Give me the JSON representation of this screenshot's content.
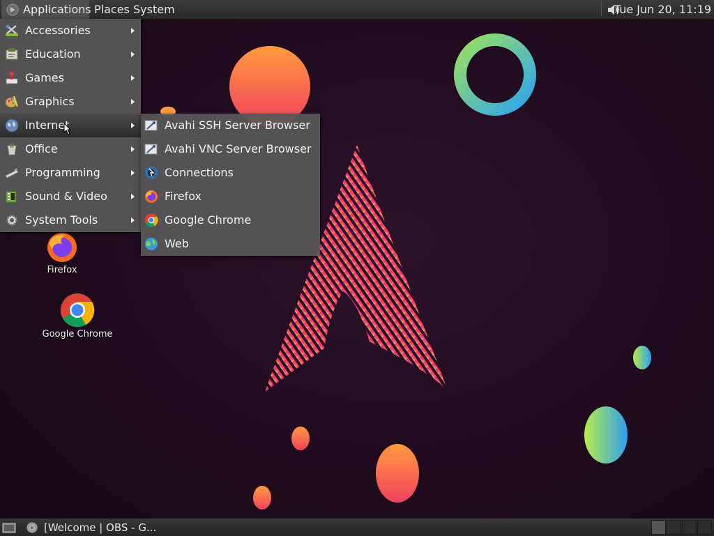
{
  "top_panel": {
    "menus": [
      "Applications",
      "Places",
      "System"
    ],
    "clock": "Tue Jun 20, 11:19"
  },
  "applications_menu": {
    "items": [
      {
        "label": "Accessories",
        "icon": "accessories-icon"
      },
      {
        "label": "Education",
        "icon": "education-icon"
      },
      {
        "label": "Games",
        "icon": "games-icon"
      },
      {
        "label": "Graphics",
        "icon": "graphics-icon"
      },
      {
        "label": "Internet",
        "icon": "globe-icon",
        "highlighted": true
      },
      {
        "label": "Office",
        "icon": "office-icon"
      },
      {
        "label": "Programming",
        "icon": "programming-icon"
      },
      {
        "label": "Sound & Video",
        "icon": "sound-video-icon"
      },
      {
        "label": "System Tools",
        "icon": "gear-icon"
      }
    ]
  },
  "internet_submenu": {
    "items": [
      {
        "label": "Avahi SSH Server Browser",
        "icon": "avahi-ssh-icon"
      },
      {
        "label": "Avahi VNC Server Browser",
        "icon": "avahi-vnc-icon"
      },
      {
        "label": "Connections",
        "icon": "connections-icon"
      },
      {
        "label": "Firefox",
        "icon": "firefox-icon"
      },
      {
        "label": "Google Chrome",
        "icon": "chrome-icon"
      },
      {
        "label": "Web",
        "icon": "web-icon"
      }
    ]
  },
  "desktop_icons": [
    {
      "label": "Firefox",
      "icon": "firefox-icon"
    },
    {
      "label": "Google Chrome",
      "icon": "chrome-icon"
    }
  ],
  "bottom_panel": {
    "task": "[Welcome | OBS - G..."
  },
  "colors": {
    "panel": "#2e2e2e",
    "menu": "#585858",
    "wallpaper": "#220d20",
    "accent_pink": "#e8266e",
    "accent_orange": "#ff8a3c"
  }
}
